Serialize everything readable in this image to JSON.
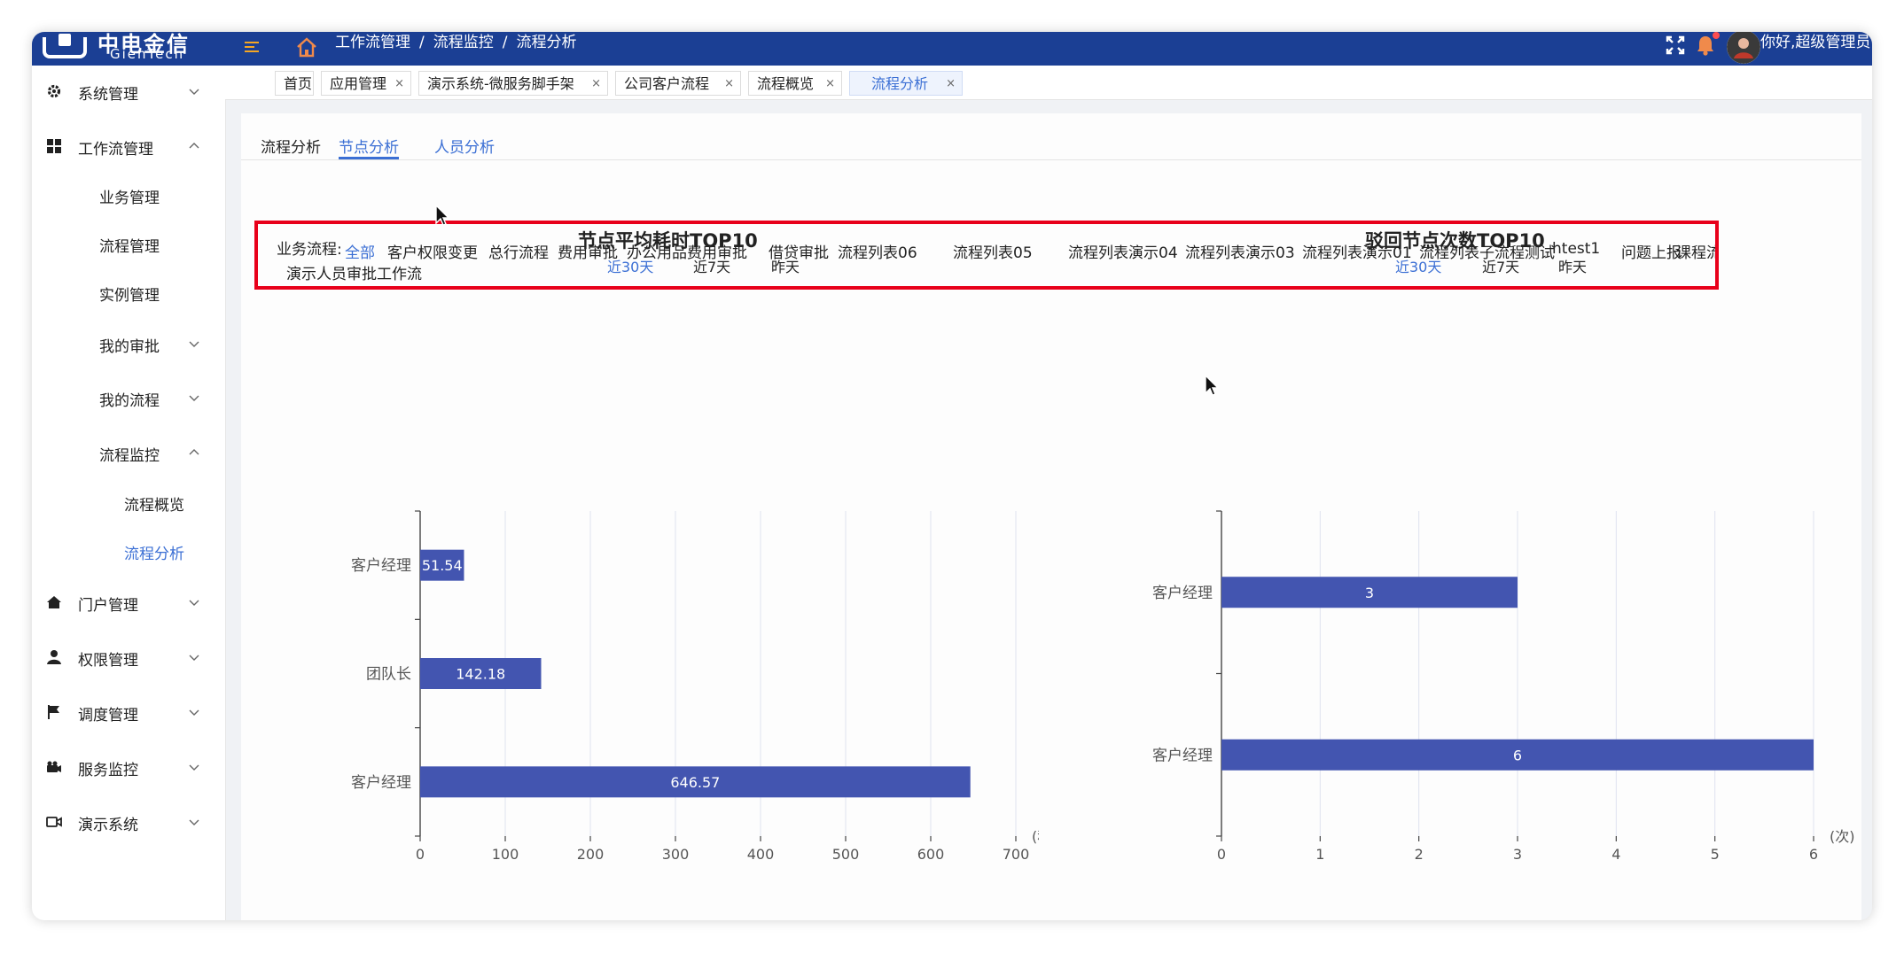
{
  "header": {
    "logo_cn": "中电金信",
    "logo_en": "GienTech",
    "breadcrumb": [
      "工作流管理",
      "流程监控",
      "流程分析"
    ],
    "greeting": "你好,超级管理员"
  },
  "sidebar": {
    "items": [
      {
        "label": "系统管理",
        "icon": "gear-icon"
      },
      {
        "label": "工作流管理",
        "icon": "grid-icon"
      },
      {
        "label": "业务管理"
      },
      {
        "label": "流程管理"
      },
      {
        "label": "实例管理"
      },
      {
        "label": "我的审批"
      },
      {
        "label": "我的流程"
      },
      {
        "label": "流程监控"
      },
      {
        "label": "流程概览"
      },
      {
        "label": "流程分析"
      },
      {
        "label": "门户管理",
        "icon": "home-icon"
      },
      {
        "label": "权限管理",
        "icon": "user-icon"
      },
      {
        "label": "调度管理",
        "icon": "flag-icon"
      },
      {
        "label": "服务监控",
        "icon": "camera-icon"
      },
      {
        "label": "演示系统",
        "icon": "video-icon"
      }
    ]
  },
  "tabs": [
    {
      "label": "首页"
    },
    {
      "label": "应用管理"
    },
    {
      "label": "演示系统-微服务脚手架"
    },
    {
      "label": "公司客户流程"
    },
    {
      "label": "流程概览"
    },
    {
      "label": "流程分析"
    }
  ],
  "subtabs": [
    "流程分析",
    "节点分析",
    "人员分析"
  ],
  "filter": {
    "label": "业务流程:",
    "options": [
      "全部",
      "客户权限变更",
      "总行流程",
      "费用审批",
      "办公用品费用审批",
      "借贷审批",
      "流程列表06",
      "流程列表05",
      "流程列表演示04",
      "流程列表演示03",
      "流程列表演示01",
      "流程列表子流程测试",
      "htest1",
      "问题上报",
      "课程流程",
      "演示人员审批工作流"
    ]
  },
  "time_ranges": [
    "近30天",
    "近7天",
    "昨天"
  ],
  "colors": {
    "accent": "#3b6fd4",
    "bar": "#4355b0",
    "header": "#1b3f94",
    "highlight_box": "#e8001a"
  },
  "chart_data": [
    {
      "type": "bar",
      "orientation": "horizontal",
      "title": "节点平均耗时TOP10",
      "categories": [
        "客户经理",
        "团队长",
        "客户经理"
      ],
      "values": [
        51.54,
        142.18,
        646.57
      ],
      "data_labels": [
        "51.54",
        "142.18",
        "646.57"
      ],
      "x_ticks": [
        "0",
        "100",
        "200",
        "300",
        "400",
        "500",
        "600",
        "700"
      ],
      "unit": "(秒)",
      "xlim": [
        0,
        700
      ],
      "grid": "vertical"
    },
    {
      "type": "bar",
      "orientation": "horizontal",
      "title": "驳回节点次数TOP10",
      "categories": [
        "客户经理",
        "客户经理"
      ],
      "values": [
        3,
        6
      ],
      "data_labels": [
        "3",
        "6"
      ],
      "x_ticks": [
        "0",
        "1",
        "2",
        "3",
        "4",
        "5",
        "6"
      ],
      "unit": "(次)",
      "xlim": [
        0,
        6
      ],
      "grid": "vertical"
    }
  ]
}
